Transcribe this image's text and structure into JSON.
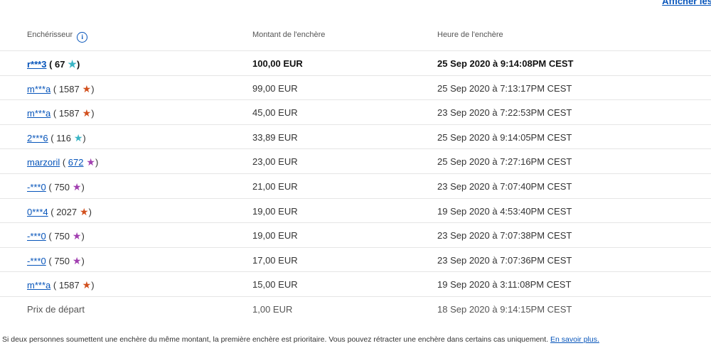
{
  "top_link": "Afficher les enc",
  "header": {
    "bidder": "Enchérisseur",
    "amount": "Montant de l'enchère",
    "time": "Heure de l'enchère"
  },
  "star_colors": {
    "turquoise": "#3ab5c5",
    "red": "#d2501e",
    "purple": "#a13fb0"
  },
  "rows": [
    {
      "bidder": "r***3",
      "score": "67",
      "star": "turquoise",
      "amount": "100,00 EUR",
      "time": "25 Sep 2020 à 9:14:08PM CEST"
    },
    {
      "bidder": "m***a",
      "score": "1587",
      "star": "red",
      "amount": "99,00 EUR",
      "time": "25 Sep 2020 à 7:13:17PM CEST"
    },
    {
      "bidder": "m***a",
      "score": "1587",
      "star": "red",
      "amount": "45,00 EUR",
      "time": "23 Sep 2020 à 7:22:53PM CEST"
    },
    {
      "bidder": "2***6",
      "score": "116",
      "star": "turquoise",
      "amount": "33,89 EUR",
      "time": "25 Sep 2020 à 9:14:05PM CEST"
    },
    {
      "bidder": "marzoril",
      "score": "672",
      "star": "purple",
      "amount": "23,00 EUR",
      "time": "25 Sep 2020 à 7:27:16PM CEST",
      "score_link": true
    },
    {
      "bidder": "-***0",
      "score": "750",
      "star": "purple",
      "amount": "21,00 EUR",
      "time": "23 Sep 2020 à 7:07:40PM CEST"
    },
    {
      "bidder": "0***4",
      "score": "2027",
      "star": "red",
      "amount": "19,00 EUR",
      "time": "19 Sep 2020 à 4:53:40PM CEST"
    },
    {
      "bidder": "-***0",
      "score": "750",
      "star": "purple",
      "amount": "19,00 EUR",
      "time": "23 Sep 2020 à 7:07:38PM CEST"
    },
    {
      "bidder": "-***0",
      "score": "750",
      "star": "purple",
      "amount": "17,00 EUR",
      "time": "23 Sep 2020 à 7:07:36PM CEST"
    },
    {
      "bidder": "m***a",
      "score": "1587",
      "star": "red",
      "amount": "15,00 EUR",
      "time": "19 Sep 2020 à 3:11:08PM CEST"
    }
  ],
  "starting_price": {
    "label": "Prix de départ",
    "amount": "1,00 EUR",
    "time": "18 Sep 2020 à 9:14:15PM CEST"
  },
  "footnote": {
    "text": "Si deux personnes soumettent une enchère du même montant, la première enchère est prioritaire. Vous pouvez rétracter une enchère dans certains cas uniquement.",
    "link": "En savoir plus."
  }
}
